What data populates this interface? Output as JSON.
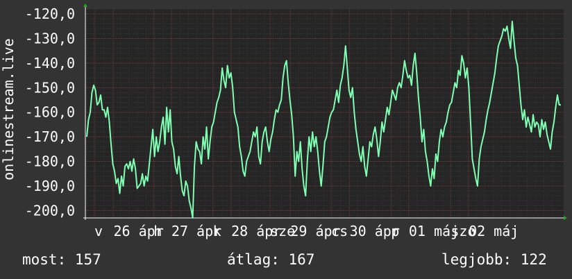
{
  "chart_data": {
    "type": "line",
    "title": "",
    "ylabel": "onlinestream.live",
    "xlabel": "",
    "ylim": [
      -203,
      -118
    ],
    "yticks": [
      -120,
      -130,
      -140,
      -150,
      -160,
      -170,
      -180,
      -190,
      -200
    ],
    "ytick_labels": [
      "-120,0",
      "-130,0",
      "-140,0",
      "-150,0",
      "-160,0",
      "-170,0",
      "-180,0",
      "-190,0",
      "-200,0"
    ],
    "xlim": [
      0,
      7.45
    ],
    "xticks": [
      {
        "x": 0.12,
        "label": "v"
      },
      {
        "x": 0.42,
        "label": "26 ápr"
      },
      {
        "x": 1.05,
        "label": "h"
      },
      {
        "x": 1.33,
        "label": "27 ápr"
      },
      {
        "x": 1.98,
        "label": "k"
      },
      {
        "x": 2.27,
        "label": "28 ápr"
      },
      {
        "x": 2.88,
        "label": "sze"
      },
      {
        "x": 3.2,
        "label": "29 ápr"
      },
      {
        "x": 3.84,
        "label": "cs"
      },
      {
        "x": 4.13,
        "label": "30 ápr"
      },
      {
        "x": 4.78,
        "label": "p"
      },
      {
        "x": 5.06,
        "label": "01 máj"
      },
      {
        "x": 5.72,
        "label": "szo"
      },
      {
        "x": 6.0,
        "label": "02 máj"
      }
    ],
    "grid": true,
    "line_color": "#7fffb2",
    "series": [
      {
        "values": [
          -170,
          -163,
          -160,
          -152,
          -149,
          -151,
          -157,
          -156,
          -153,
          -159,
          -159,
          -162,
          -158,
          -164,
          -173,
          -181,
          -184,
          -189,
          -187,
          -193,
          -186,
          -190,
          -182,
          -181,
          -183,
          -180,
          -184,
          -179,
          -183,
          -191,
          -190,
          -189,
          -185,
          -190,
          -186,
          -188,
          -181,
          -174,
          -167,
          -178,
          -170,
          -176,
          -172,
          -166,
          -162,
          -173,
          -158,
          -168,
          -159,
          -172,
          -175,
          -182,
          -185,
          -178,
          -186,
          -192,
          -194,
          -188,
          -190,
          -196,
          -199,
          -203,
          -182,
          -172,
          -175,
          -176,
          -181,
          -170,
          -175,
          -166,
          -179,
          -172,
          -166,
          -164,
          -160,
          -156,
          -154,
          -151,
          -142,
          -147,
          -150,
          -141,
          -146,
          -144,
          -150,
          -160,
          -163,
          -166,
          -174,
          -178,
          -184,
          -186,
          -180,
          -178,
          -176,
          -172,
          -168,
          -170,
          -166,
          -178,
          -181,
          -172,
          -168,
          -166,
          -172,
          -176,
          -171,
          -168,
          -163,
          -159,
          -160,
          -157,
          -155,
          -146,
          -141,
          -139,
          -148,
          -155,
          -161,
          -170,
          -186,
          -176,
          -180,
          -172,
          -183,
          -190,
          -194,
          -180,
          -170,
          -176,
          -168,
          -174,
          -170,
          -176,
          -184,
          -190,
          -182,
          -172,
          -170,
          -166,
          -162,
          -160,
          -159,
          -155,
          -151,
          -156,
          -149,
          -146,
          -141,
          -133,
          -142,
          -151,
          -154,
          -150,
          -160,
          -167,
          -172,
          -177,
          -180,
          -174,
          -182,
          -186,
          -179,
          -172,
          -174,
          -169,
          -166,
          -171,
          -178,
          -172,
          -164,
          -168,
          -163,
          -158,
          -161,
          -156,
          -151,
          -153,
          -155,
          -150,
          -148,
          -150,
          -145,
          -139,
          -143,
          -146,
          -145,
          -149,
          -141,
          -136,
          -144,
          -154,
          -162,
          -172,
          -167,
          -176,
          -180,
          -186,
          -190,
          -183,
          -187,
          -177,
          -180,
          -172,
          -167,
          -170,
          -166,
          -164,
          -160,
          -157,
          -156,
          -152,
          -148,
          -150,
          -143,
          -145,
          -137,
          -140,
          -146,
          -142,
          -150,
          -164,
          -179,
          -183,
          -187,
          -190,
          -179,
          -174,
          -171,
          -168,
          -163,
          -159,
          -156,
          -152,
          -148,
          -144,
          -138,
          -133,
          -131,
          -129,
          -126,
          -127,
          -125,
          -130,
          -134,
          -123,
          -131,
          -138,
          -141,
          -149,
          -157,
          -163,
          -159,
          -166,
          -162,
          -165,
          -168,
          -161,
          -166,
          -164,
          -165,
          -170,
          -163,
          -167,
          -164,
          -169,
          -172,
          -175,
          -168,
          -164,
          -158,
          -153,
          -157,
          -157
        ]
      }
    ]
  },
  "stats": {
    "now_text": "most: 157",
    "avg_text": "átlag: 167",
    "best_text": "legjobb: 122"
  }
}
